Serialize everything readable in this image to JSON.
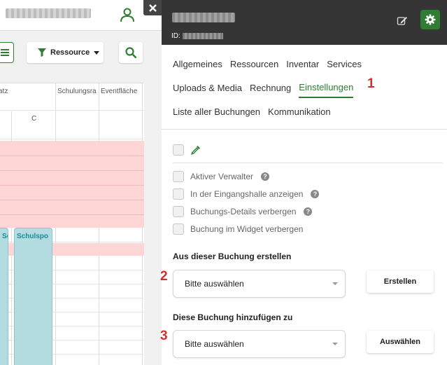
{
  "background_app": {
    "resource_filter_label": "Ressource",
    "columns": [
      {
        "label": "atz"
      },
      {
        "label": "Schulungsra"
      },
      {
        "label": "Eventfläche"
      }
    ],
    "sub_header": "C",
    "bookings": [
      {
        "label": "Schulspo"
      },
      {
        "label": "Schulspo"
      }
    ]
  },
  "panel": {
    "id_label": "ID:",
    "tabs_row1": [
      {
        "label": "Allgemeines"
      },
      {
        "label": "Ressourcen"
      },
      {
        "label": "Inventar"
      },
      {
        "label": "Services"
      }
    ],
    "tabs_row2": [
      {
        "label": "Uploads & Media"
      },
      {
        "label": "Rechnung"
      },
      {
        "label": "Einstellungen",
        "active": true
      }
    ],
    "tabs_row3": [
      {
        "label": "Liste aller Buchungen"
      },
      {
        "label": "Kommunikation"
      }
    ],
    "checkboxes": [
      {
        "label": "Aktiver Verwalter",
        "help": true
      },
      {
        "label": "In der Eingangshalle anzeigen",
        "help": true
      },
      {
        "label": "Buchungs-Details verbergen",
        "help": true
      },
      {
        "label": "Buchung im Widget verbergen",
        "help": false
      }
    ],
    "create_section": {
      "title": "Aus dieser Buchung erstellen",
      "select_value": "Bitte auswählen",
      "button_label": "Erstellen"
    },
    "add_section": {
      "title": "Diese Buchung hinzufügen zu",
      "select_value": "Bitte auswählen",
      "button_label": "Auswählen"
    }
  },
  "annotations": {
    "marker_1": "1",
    "marker_2": "2",
    "marker_3": "3"
  },
  "colors": {
    "accent_green": "#2e7d32",
    "header_dark": "#353535",
    "annotation_red": "#d32f2f",
    "booking_teal": "#b2dce0",
    "conflict_pink": "#ffd6d6"
  }
}
